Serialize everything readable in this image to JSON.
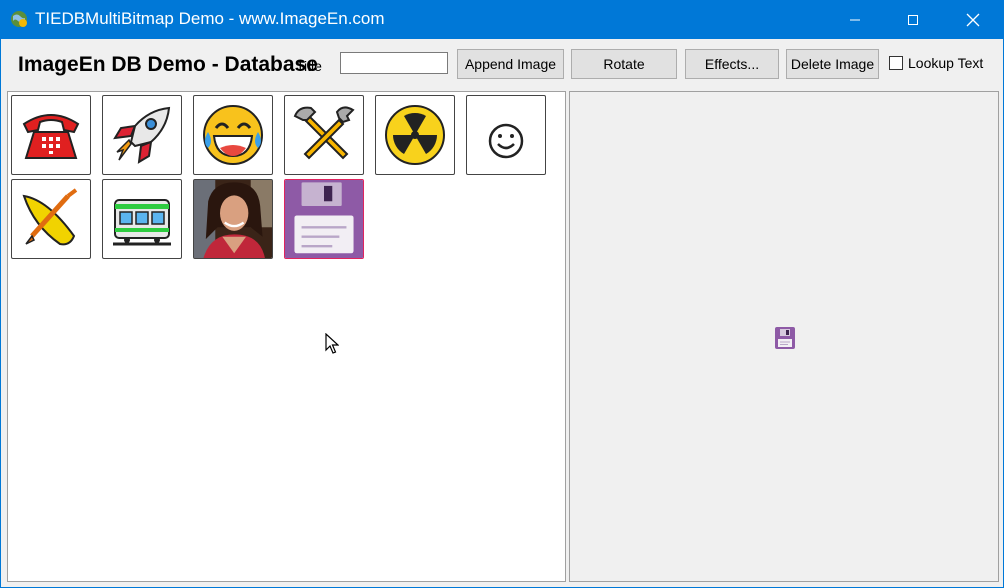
{
  "window": {
    "title": "TIEDBMultiBitmap Demo - www.ImageEn.com"
  },
  "toolbar": {
    "heading": "ImageEn DB Demo - Database",
    "field_label": "Title",
    "field_value": "",
    "append_label": "Append Image",
    "rotate_label": "Rotate",
    "effects_label": "Effects...",
    "delete_label": "Delete Image",
    "lookup_label": "Lookup Text",
    "lookup_checked": false
  },
  "thumbnails": {
    "selected_index": 9,
    "items": [
      {
        "icon": "telephone-icon"
      },
      {
        "icon": "rocket-icon"
      },
      {
        "icon": "laughing-face-icon"
      },
      {
        "icon": "tools-icon"
      },
      {
        "icon": "radioactive-icon"
      },
      {
        "icon": "smiley-icon"
      },
      {
        "icon": "canoe-icon"
      },
      {
        "icon": "tram-icon"
      },
      {
        "icon": "portrait-photo"
      },
      {
        "icon": "floppy-disk-icon"
      }
    ]
  },
  "colors": {
    "titlebar": "#0078d7",
    "selection": "#e0245e",
    "floppy": "#8e5aa6"
  }
}
